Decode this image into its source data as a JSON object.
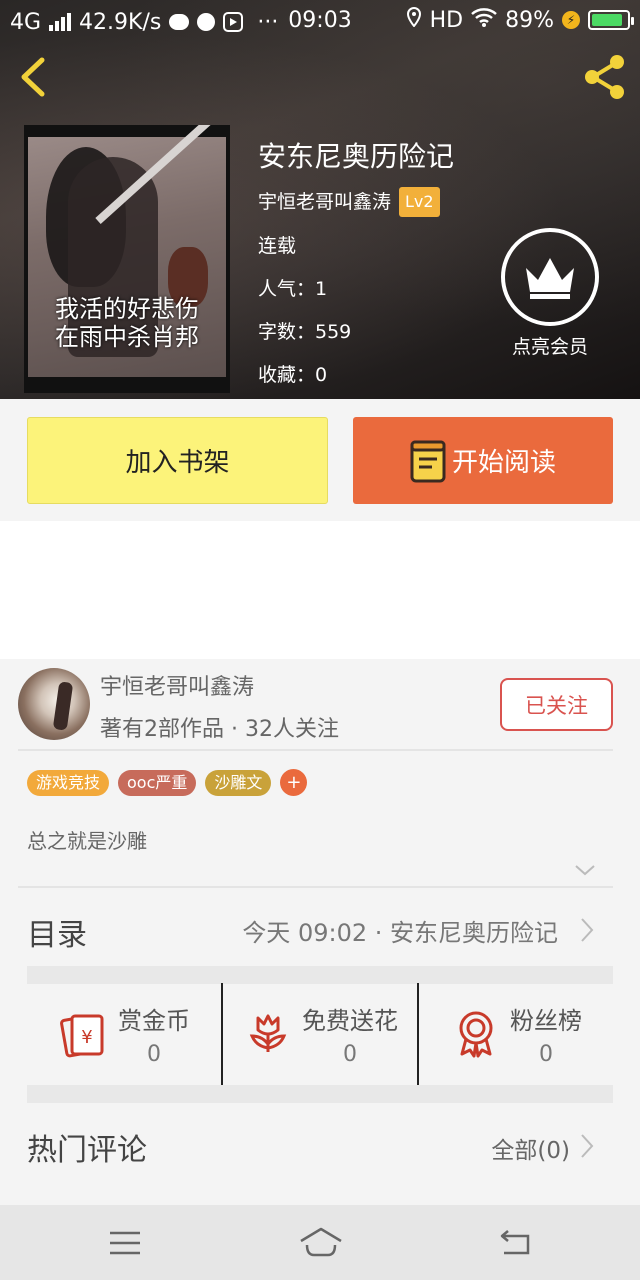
{
  "status_bar": {
    "network": "4G",
    "speed": "42.9K/s",
    "more": "···",
    "time": "09:03",
    "hd": "HD",
    "battery": "89%"
  },
  "book": {
    "title": "安东尼奥历险记",
    "author": "宇恒老哥叫鑫涛",
    "level": "Lv2",
    "status": "连载",
    "popularity": "人气：1",
    "word_count": "字数：559",
    "favorites": "收藏：0",
    "cover_caption_line1": "我活的好悲伤",
    "cover_caption_line2": "在雨中杀肖邦"
  },
  "vip": {
    "label": "点亮会员"
  },
  "actions": {
    "add_shelf": "加入书架",
    "start_read": "开始阅读"
  },
  "author_card": {
    "name": "宇恒老哥叫鑫涛",
    "stats": "著有2部作品 · 32人关注",
    "follow_label": "已关注"
  },
  "tags": [
    {
      "label": "游戏竞技",
      "color": "#f2a93b"
    },
    {
      "label": "ooc严重",
      "color": "#c76b5b"
    },
    {
      "label": "沙雕文",
      "color": "#c9a23a"
    }
  ],
  "tag_add": "+",
  "intro": "总之就是沙雕",
  "catalog": {
    "label": "目录",
    "latest": "今天 09:02 · 安东尼奥历险记"
  },
  "rewards": [
    {
      "name": "赏金币",
      "count": "0",
      "icon": "red-envelope-icon"
    },
    {
      "name": "免费送花",
      "count": "0",
      "icon": "flower-icon"
    },
    {
      "name": "粉丝榜",
      "count": "0",
      "icon": "medal-icon"
    }
  ],
  "comments": {
    "label": "热门评论",
    "all": "全部(0)"
  },
  "colors": {
    "accent_orange": "#ea6a3d",
    "shelf_yellow": "#fcf37a",
    "follow_red": "#d9534f",
    "icon_red": "#c83a2a",
    "vip_gold": "#f2b03a"
  }
}
